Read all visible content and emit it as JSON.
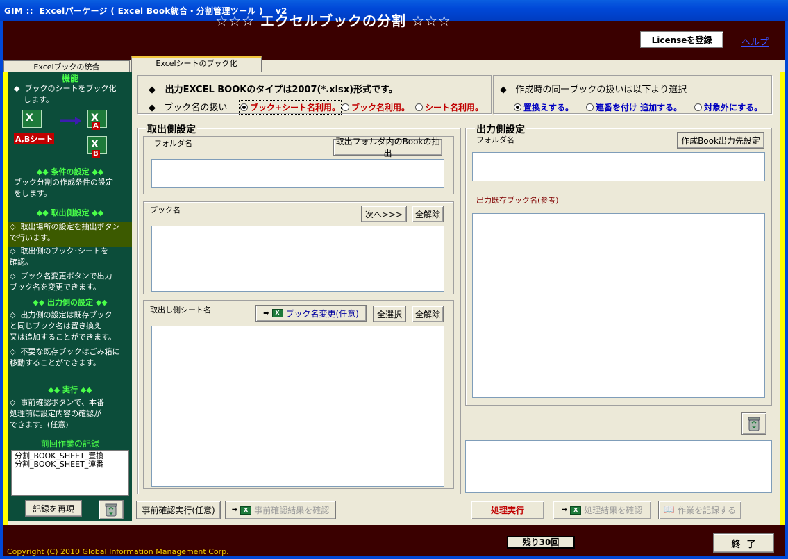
{
  "window": {
    "title": "GIM ::  Excelパーケージ ( Excel Book統合・分割管理ツール )    v2"
  },
  "header": {
    "title": "☆☆☆  エクセルブックの分割  ☆☆☆",
    "license_button": "Licenseを登録",
    "help_link": "ヘルプ"
  },
  "tabs": [
    {
      "label": "Excelブックの統合"
    },
    {
      "label": "Excelシートのブック化"
    }
  ],
  "sidebar": {
    "title": "機能",
    "intro": "◆  ブックのシートをブック化\n    します。",
    "badge_ab": "A,Bシート",
    "badge_a": "A",
    "badge_b": "B",
    "cond_head": "◆◆  条件の設定  ◆◆",
    "cond_text": "ブック分割の作成条件の設定\nをします。",
    "src_head": "◆◆  取出側設定  ◆◆",
    "src_items": [
      "取出場所の設定を抽出ボタン\nで行います。",
      "取出側のブック･シートを\n確認。",
      "ブック名変更ボタンで出力\nブック名を変更できます。"
    ],
    "out_head": "◆◆  出力側の設定  ◆◆",
    "out_items": [
      "出力側の設定は既存ブック\nと同じブック名は置き換え\n又は追加することができます。",
      "不要な既存ブックはごみ箱に\n移動することができます。"
    ],
    "exec_head": "◆◆    実行    ◆◆",
    "exec_items": [
      "事前確認ボタンで、本番\n処理前に設定内容の確認が\nできます。(任意)"
    ],
    "history_title": "前回作業の記録",
    "history": [
      "分割_BOOK_SHEET_置換",
      "分割_BOOK_SHEET_連番"
    ],
    "replay_button": "記録を再現"
  },
  "settings": {
    "output_type": "出力EXCEL BOOKのタイプは2007(*.xlsx)形式です。",
    "bookname_label": "ブック名の扱い",
    "bookname_options": [
      "ブック+シート名利用。",
      "ブック名利用。",
      "シート名利用。"
    ],
    "same_book_label": "作成時の同一ブックの扱いは以下より選択",
    "same_book_options": [
      "置換えする。",
      "連番を付け 追加する。",
      "対象外にする。"
    ]
  },
  "source": {
    "title": "取出側設定",
    "folder_label": "フォルダ名",
    "extract_button": "取出フォルダ内のBookの抽出",
    "book_label": "ブック名",
    "next_button": "次へ>>>",
    "clear_button": "全解除",
    "sheet_label": "取出し側シート名",
    "rename_button": "ブック名変更(任意)",
    "select_all_button": "全選択",
    "sheet_clear_button": "全解除"
  },
  "output": {
    "title": "出力側設定",
    "folder_label": "フォルダ名",
    "dest_button": "作成Book出力先設定",
    "existing_label": "出力既存ブック名(参考)"
  },
  "actions": {
    "precheck_button": "事前確認実行(任意)",
    "precheck_result_button": "事前確認結果を確認",
    "execute_button": "処理実行",
    "result_button": "処理結果を確認",
    "record_button": "作業を記録する"
  },
  "footer": {
    "copyright": "Copyright (C) 2010 Global Information Management Corp.",
    "remaining": "残り30回",
    "exit_button": "終  了"
  }
}
